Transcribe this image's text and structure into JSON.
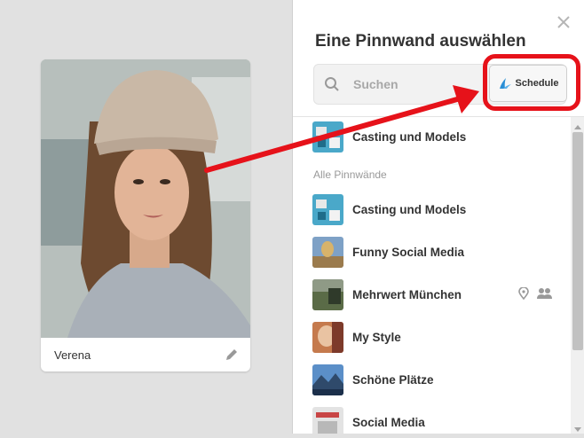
{
  "pin": {
    "caption": "Verena"
  },
  "panel": {
    "title": "Eine Pinnwand auswählen",
    "search_placeholder": "Suchen",
    "schedule_label": "Schedule",
    "section_label": "Alle Pinnwände",
    "recent_board": "Casting und Models",
    "boards": [
      "Casting und Models",
      "Funny Social Media",
      "Mehrwert München",
      "My Style",
      "Schöne Plätze",
      "Social Media"
    ]
  },
  "colors": {
    "highlight": "#e6121a",
    "schedule_brand": "#2a8fd6"
  },
  "icons": {
    "close": "close-icon",
    "search": "search-icon",
    "schedule": "schedule-logo-icon",
    "edit": "pencil-icon",
    "location": "map-pin-icon",
    "collaborators": "group-icon"
  }
}
